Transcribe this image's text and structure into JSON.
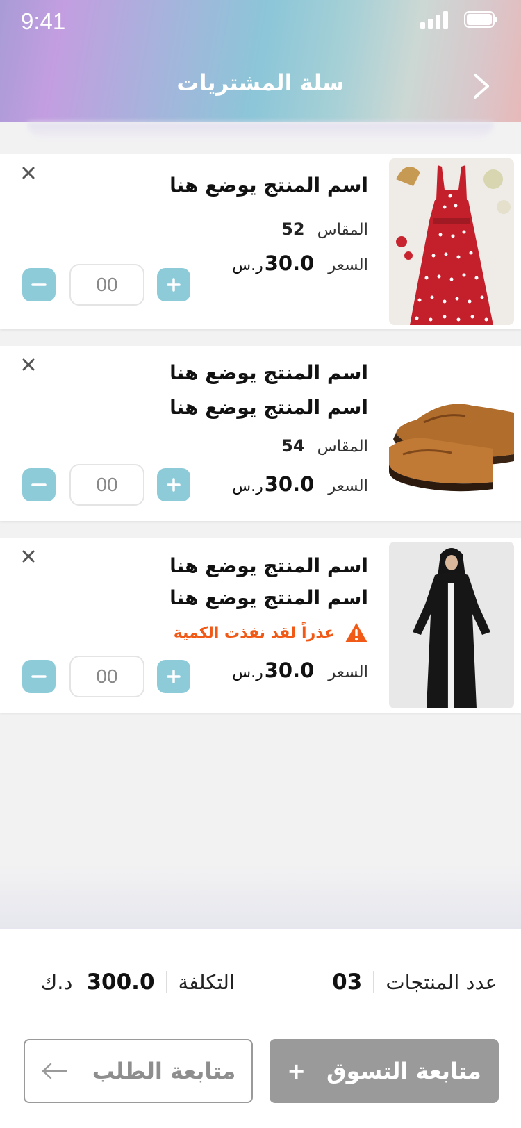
{
  "status_bar": {
    "time": "9:41"
  },
  "header": {
    "title": "سلة المشتريات"
  },
  "cart_items": [
    {
      "name_lines": [
        "اسم المنتج يوضع هنا"
      ],
      "size_label": "المقاس",
      "size_value": "52",
      "price_label": "السعر",
      "price_value": "30.0",
      "currency": "ر.س",
      "quantity": "00",
      "image": "red-polka-dot-dress"
    },
    {
      "name_lines": [
        "اسم المنتج يوضع هنا",
        "اسم المنتج يوضع هنا"
      ],
      "size_label": "المقاس",
      "size_value": "54",
      "price_label": "السعر",
      "price_value": "30.0",
      "currency": "ر.س",
      "quantity": "00",
      "image": "brown-leather-shoes"
    },
    {
      "name_lines": [
        "اسم المنتج يوضع هنا",
        "اسم المنتج يوضع هنا"
      ],
      "warning": "عذراً لقد نفذت الكمية",
      "price_label": "السعر",
      "price_value": "30.0",
      "currency": "ر.س",
      "quantity": "00",
      "image": "black-abaya"
    }
  ],
  "summary": {
    "count_label": "عدد المنتجات",
    "count_value": "03",
    "cost_label": "التكلفة",
    "cost_value": "300.0",
    "cost_currency": "د.ك"
  },
  "buttons": {
    "continue_shopping": "متابعة التسوق",
    "continue_shopping_icon": "+",
    "continue_order": "متابعة الطلب"
  },
  "colors": {
    "accent": "#8ecbd9",
    "warning": "#f05a16",
    "button_gray": "#9a9a9a"
  },
  "icons": {
    "back": "chevron-right-icon",
    "remove": "close-icon",
    "plus": "plus-icon",
    "minus": "minus-icon",
    "warning": "warning-triangle-icon",
    "arrow": "arrow-left-icon"
  }
}
